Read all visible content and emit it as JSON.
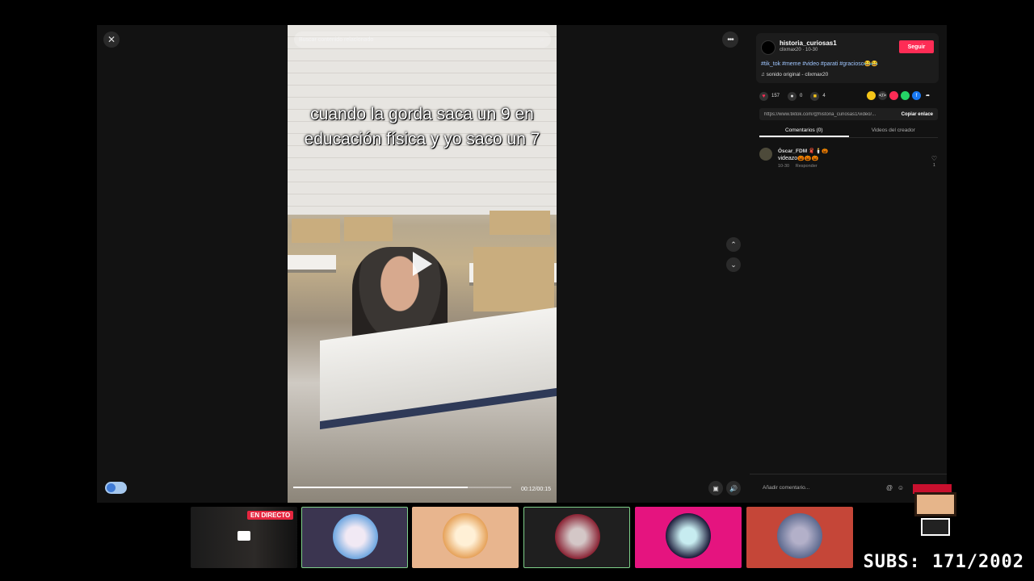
{
  "player": {
    "search_placeholder": "Buscar contenido relacionado",
    "caption": "cuando la gorda saca un 9 en educación física y yo saco un 7",
    "time": "00:12/00:15",
    "progress_fraction": 0.8
  },
  "author": {
    "username": "historia_curiosas1",
    "sub": "clixmax20 · 10-30",
    "follow_label": "Seguir",
    "hashtags": "#tik_tok #meme #video #parati #gracioso😂😂",
    "music": "♫  sonido original - clixmax20"
  },
  "stats": {
    "likes": "157",
    "comments": "0",
    "saves": "4"
  },
  "link": {
    "url": "https://www.tiktok.com/@historia_curiosas1/video/...",
    "copy_label": "Copiar enlace"
  },
  "tabs": [
    {
      "label": "Comentarios (0)"
    },
    {
      "label": "Videos del creador"
    }
  ],
  "comments": [
    {
      "name": "Óscar_FDM 🧣🕯️🎃",
      "text": "videazo🎃🎃🎃",
      "date": "10-30",
      "reply": "Responder",
      "likes": "1"
    }
  ],
  "add_comment_placeholder": "Añadir comentario...",
  "stream": {
    "live_label": "EN DIRECTO",
    "subs": "SUBS: 171/2002"
  },
  "colors": {
    "accent": "#fe2c55",
    "background": "#121212"
  },
  "icons": {
    "close": "✕",
    "more": "•••",
    "search": "⌕",
    "up": "⌃",
    "down": "⌄",
    "heart": "♥",
    "comment": "💬",
    "bookmark": "🔖"
  }
}
